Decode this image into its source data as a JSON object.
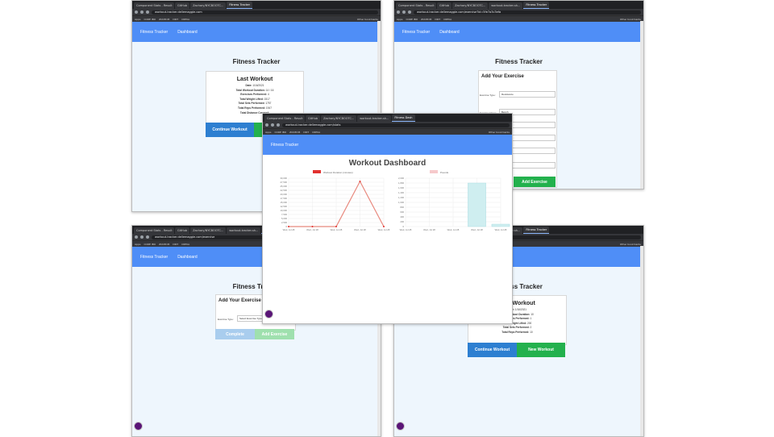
{
  "colors": {
    "nav": "#4f8ef7",
    "continue": "#2d7fd1",
    "new": "#23b14d",
    "line": "#e8897e",
    "bar": "#cfeef0"
  },
  "browser": {
    "tabs_a": [
      "Component Stats - Result",
      "GitHub",
      "Zachary/NYCBOOTC...",
      "Fitness Tracker"
    ],
    "tabs_b": [
      "Component Stats - Result",
      "GitHub",
      "Zachary/NYCBOOTC...",
      "workout-tracker-sh...",
      "Fitness Tracker"
    ],
    "tabs_c": [
      "Component Stats - Result",
      "GitHub",
      "Zachary/NYCBOOTC...",
      "workout-tracker-sh...",
      "Fitness Tracker"
    ],
    "tabs_center": [
      "Component Stats - Result",
      "GitHub",
      "Zachary/NYCBOOTC...",
      "workout-tracker-sh...",
      "Fitness Dash"
    ],
    "tabs_d": [
      "Component Stats - Result",
      "GitHub",
      "Zachary/NYCBOOTC...",
      "workout-tracker-sh...",
      "Fitness Tracker"
    ],
    "url_a": "workout-tracker.dellemaggie.com",
    "url_b": "workout-tracker.dellemaggie.com/exercise?id=5fe7a3c3efa",
    "url_center": "workout-tracker.dellemaggie.com/stats",
    "url_c": "workout-tracker.dellemaggie.com/exercise",
    "url_d": "workout-tracker.dellemaggie.com",
    "bookmarks": [
      "Apps",
      "CORE IBO",
      "ZOOM IB",
      "DIKT",
      "CREKA"
    ],
    "other_bookmarks": "Other bookmarks"
  },
  "nav": {
    "brand": "Fitness Tracker",
    "dashboard": "Dashboard"
  },
  "window_a": {
    "title": "Fitness Tracker",
    "card_title": "Last Workout",
    "stats": [
      {
        "label": "Date:",
        "value": "1/16/2021"
      },
      {
        "label": "Total Workout Duration:",
        "value": "14 / 16"
      },
      {
        "label": "Exercises Performed:",
        "value": "4"
      },
      {
        "label": "Total Weight Lifted:",
        "value": "1517"
      },
      {
        "label": "Total Sets Performed:",
        "value": "1757"
      },
      {
        "label": "Total Reps Performed:",
        "value": "1947"
      },
      {
        "label": "Total Distance Covered:",
        "value": ""
      }
    ],
    "continue": "Continue Workout",
    "new": "New Workout"
  },
  "window_b": {
    "title": "Fitness Tracker",
    "card_title": "Add Your Exercise",
    "type_label": "Exercise Type:",
    "type_value": "Resistance",
    "name_label": "Exercise Name:",
    "name_value": "Bench",
    "add": "Add Exercise"
  },
  "window_center": {
    "title": "Workout Dashboard"
  },
  "window_c": {
    "title": "Fitness Tracker",
    "card_title": "Add Your Exercise",
    "type_label": "Exercise Type:",
    "type_value": "Select Exercise Type",
    "complete": "Complete",
    "add": "Add Exercise"
  },
  "window_d": {
    "title": "Fitness Tracker",
    "card_title": "Last Workout",
    "stats": [
      {
        "label": "Date:",
        "value": "1/16/2021"
      },
      {
        "label": "Total Workout Duration:",
        "value": "10"
      },
      {
        "label": "Exercises Performed:",
        "value": "1"
      },
      {
        "label": "Total Weight Lifted:",
        "value": "200"
      },
      {
        "label": "Total Sets Performed:",
        "value": "2"
      },
      {
        "label": "Total Reps Performed:",
        "value": "10"
      }
    ],
    "continue": "Continue Workout",
    "new": "New Workout"
  },
  "chart_data": [
    {
      "type": "line",
      "title": "",
      "legend": "Workout Duration (minutes)",
      "categories": [
        "Wed, Jul 28",
        "Wed, Jul 28",
        "Wed, Jul 28",
        "Wed, Jul 28",
        "Wed, Jul 28"
      ],
      "values": [
        0,
        0,
        0,
        28000,
        0
      ],
      "ylim": [
        0,
        30000
      ],
      "yticks": [
        "30,000",
        "27,500",
        "25,000",
        "22,500",
        "20,000",
        "17,500",
        "15,000",
        "12,500",
        "10,000",
        "7,500",
        "5,000",
        "2,500",
        "0"
      ]
    },
    {
      "type": "bar",
      "title": "",
      "legend": "Pounds",
      "categories": [
        "Wed, Jul 28",
        "Wed, Jul 28",
        "Wed, Jul 28",
        "Wed, Jul 28",
        "Wed, Jul 28"
      ],
      "values": [
        0,
        0,
        0,
        1800,
        100
      ],
      "ylim": [
        0,
        2000
      ],
      "yticks": [
        "2,000",
        "1,800",
        "1,600",
        "1,400",
        "1,200",
        "1,000",
        "800",
        "600",
        "400",
        "200",
        "0"
      ]
    }
  ]
}
